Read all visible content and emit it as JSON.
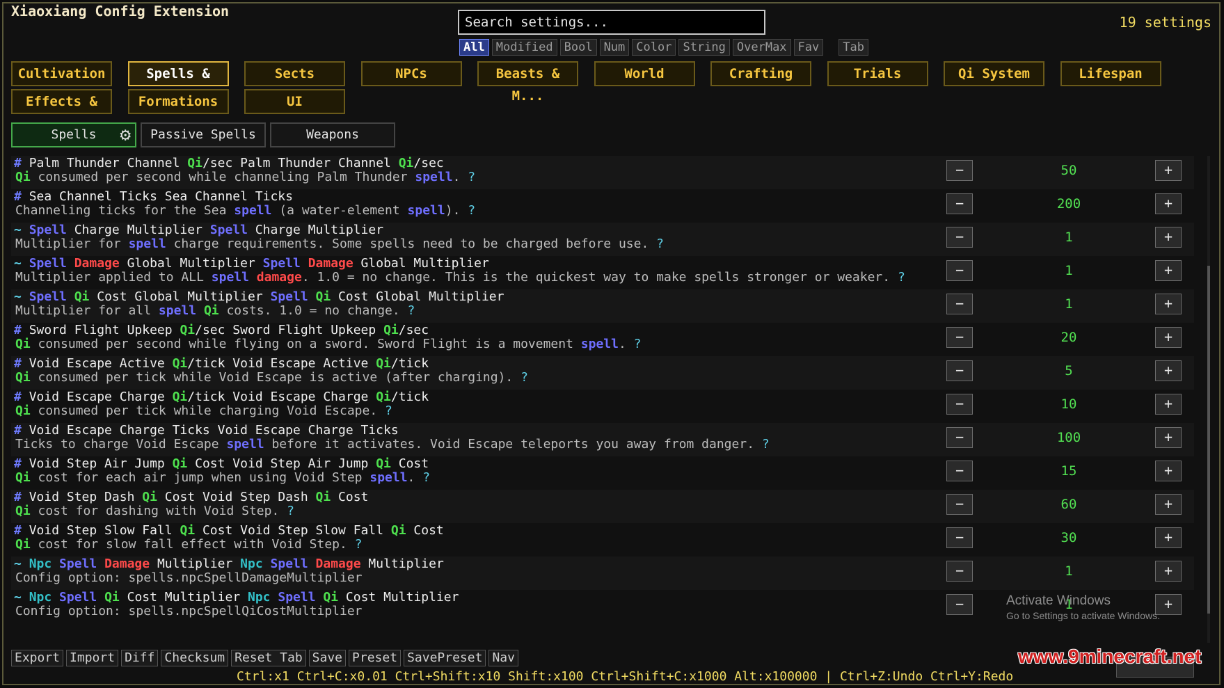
{
  "header": {
    "title": "Xiaoxiang Config Extension",
    "settings_count": "19 settings",
    "search_placeholder": "Search settings..."
  },
  "filters": [
    "All",
    "Modified",
    "Bool",
    "Num",
    "Color",
    "String",
    "OverMax",
    "Fav"
  ],
  "filter_tab": "Tab",
  "categories": [
    "Cultivation",
    "Spells & C...",
    "Sects",
    "NPCs",
    "Beasts & M...",
    "World",
    "Crafting",
    "Trials",
    "Qi System",
    "Lifespan",
    "Effects & ...",
    "Formations",
    "UI"
  ],
  "active_category": "Spells & C...",
  "subtabs": [
    "Spells",
    "Passive Spells",
    "Weapons"
  ],
  "active_subtab": "Spells",
  "settings": [
    {
      "marker": "#",
      "name": [
        [
          "t",
          "Palm Thunder Channel "
        ],
        [
          "qi",
          "Qi"
        ],
        [
          "t",
          "/sec Palm Thunder Channel "
        ],
        [
          "qi",
          "Qi"
        ],
        [
          "t",
          "/sec"
        ]
      ],
      "desc": [
        [
          "qi",
          "Qi"
        ],
        [
          "t",
          " consumed per second while channeling Palm Thunder "
        ],
        [
          "spell",
          "spell"
        ],
        [
          "t",
          "."
        ],
        [
          "help",
          " ?"
        ]
      ],
      "value": "50"
    },
    {
      "marker": "#",
      "name": [
        [
          "t",
          "Sea Channel Ticks Sea Channel Ticks"
        ]
      ],
      "desc": [
        [
          "t",
          "Channeling ticks for the Sea "
        ],
        [
          "spell",
          "spell"
        ],
        [
          "t",
          " (a water-element "
        ],
        [
          "spell",
          "spell"
        ],
        [
          "t",
          ")."
        ],
        [
          "help",
          " ?"
        ]
      ],
      "value": "200"
    },
    {
      "marker": "~",
      "name": [
        [
          "spell",
          "Spell"
        ],
        [
          "t",
          " Charge Multiplier "
        ],
        [
          "spell",
          "Spell"
        ],
        [
          "t",
          " Charge Multiplier"
        ]
      ],
      "desc": [
        [
          "t",
          "Multiplier for "
        ],
        [
          "spell",
          "spell"
        ],
        [
          "t",
          " charge requirements. Some spells need to be charged before use."
        ],
        [
          "help",
          " ?"
        ]
      ],
      "value": "1"
    },
    {
      "marker": "~",
      "name": [
        [
          "spell",
          "Spell"
        ],
        [
          "t",
          " "
        ],
        [
          "dmg",
          "Damage"
        ],
        [
          "t",
          " Global Multiplier "
        ],
        [
          "spell",
          "Spell"
        ],
        [
          "t",
          " "
        ],
        [
          "dmg",
          "Damage"
        ],
        [
          "t",
          " Global Multiplier"
        ]
      ],
      "desc": [
        [
          "t",
          "Multiplier applied to ALL "
        ],
        [
          "spell",
          "spell"
        ],
        [
          "t",
          " "
        ],
        [
          "dmg",
          "damage"
        ],
        [
          "t",
          ". 1.0 = no change. This is the quickest way to make spells stronger or weaker."
        ],
        [
          "help",
          " ?"
        ]
      ],
      "value": "1"
    },
    {
      "marker": "~",
      "name": [
        [
          "spell",
          "Spell"
        ],
        [
          "t",
          " "
        ],
        [
          "qi",
          "Qi"
        ],
        [
          "t",
          " Cost Global Multiplier "
        ],
        [
          "spell",
          "Spell"
        ],
        [
          "t",
          " "
        ],
        [
          "qi",
          "Qi"
        ],
        [
          "t",
          " Cost Global Multiplier"
        ]
      ],
      "desc": [
        [
          "t",
          "Multiplier for all "
        ],
        [
          "spell",
          "spell"
        ],
        [
          "t",
          " "
        ],
        [
          "qi",
          "Qi"
        ],
        [
          "t",
          " costs. 1.0 = no change."
        ],
        [
          "help",
          " ?"
        ]
      ],
      "value": "1"
    },
    {
      "marker": "#",
      "name": [
        [
          "t",
          "Sword Flight Upkeep "
        ],
        [
          "qi",
          "Qi"
        ],
        [
          "t",
          "/sec Sword Flight Upkeep "
        ],
        [
          "qi",
          "Qi"
        ],
        [
          "t",
          "/sec"
        ]
      ],
      "desc": [
        [
          "qi",
          "Qi"
        ],
        [
          "t",
          " consumed per second while flying on a sword. Sword Flight is a movement "
        ],
        [
          "spell",
          "spell"
        ],
        [
          "t",
          "."
        ],
        [
          "help",
          " ?"
        ]
      ],
      "value": "20"
    },
    {
      "marker": "#",
      "name": [
        [
          "t",
          "Void Escape Active "
        ],
        [
          "qi",
          "Qi"
        ],
        [
          "t",
          "/tick Void Escape Active "
        ],
        [
          "qi",
          "Qi"
        ],
        [
          "t",
          "/tick"
        ]
      ],
      "desc": [
        [
          "qi",
          "Qi"
        ],
        [
          "t",
          " consumed per tick while Void Escape is active (after charging)."
        ],
        [
          "help",
          " ?"
        ]
      ],
      "value": "5"
    },
    {
      "marker": "#",
      "name": [
        [
          "t",
          "Void Escape Charge "
        ],
        [
          "qi",
          "Qi"
        ],
        [
          "t",
          "/tick Void Escape Charge "
        ],
        [
          "qi",
          "Qi"
        ],
        [
          "t",
          "/tick"
        ]
      ],
      "desc": [
        [
          "qi",
          "Qi"
        ],
        [
          "t",
          " consumed per tick while charging Void Escape."
        ],
        [
          "help",
          " ?"
        ]
      ],
      "value": "10"
    },
    {
      "marker": "#",
      "name": [
        [
          "t",
          "Void Escape Charge Ticks Void Escape Charge Ticks"
        ]
      ],
      "desc": [
        [
          "t",
          "Ticks to charge Void Escape "
        ],
        [
          "spell",
          "spell"
        ],
        [
          "t",
          " before it activates. Void Escape teleports you away from danger."
        ],
        [
          "help",
          " ?"
        ]
      ],
      "value": "100"
    },
    {
      "marker": "#",
      "name": [
        [
          "t",
          "Void Step Air Jump "
        ],
        [
          "qi",
          "Qi"
        ],
        [
          "t",
          " Cost Void Step Air Jump "
        ],
        [
          "qi",
          "Qi"
        ],
        [
          "t",
          " Cost"
        ]
      ],
      "desc": [
        [
          "qi",
          "Qi"
        ],
        [
          "t",
          " cost for each air jump when using Void Step "
        ],
        [
          "spell",
          "spell"
        ],
        [
          "t",
          "."
        ],
        [
          "help",
          " ?"
        ]
      ],
      "value": "15"
    },
    {
      "marker": "#",
      "name": [
        [
          "t",
          "Void Step Dash "
        ],
        [
          "qi",
          "Qi"
        ],
        [
          "t",
          " Cost Void Step Dash "
        ],
        [
          "qi",
          "Qi"
        ],
        [
          "t",
          " Cost"
        ]
      ],
      "desc": [
        [
          "qi",
          "Qi"
        ],
        [
          "t",
          " cost for dashing with Void Step."
        ],
        [
          "help",
          " ?"
        ]
      ],
      "value": "60"
    },
    {
      "marker": "#",
      "name": [
        [
          "t",
          "Void Step Slow Fall "
        ],
        [
          "qi",
          "Qi"
        ],
        [
          "t",
          " Cost Void Step Slow Fall "
        ],
        [
          "qi",
          "Qi"
        ],
        [
          "t",
          " Cost"
        ]
      ],
      "desc": [
        [
          "qi",
          "Qi"
        ],
        [
          "t",
          " cost for slow fall effect with Void Step."
        ],
        [
          "help",
          " ?"
        ]
      ],
      "value": "30"
    },
    {
      "marker": "~",
      "name": [
        [
          "npc",
          "Npc"
        ],
        [
          "t",
          " "
        ],
        [
          "spell",
          "Spell"
        ],
        [
          "t",
          " "
        ],
        [
          "dmg",
          "Damage"
        ],
        [
          "t",
          " Multiplier "
        ],
        [
          "npc",
          "Npc"
        ],
        [
          "t",
          " "
        ],
        [
          "spell",
          "Spell"
        ],
        [
          "t",
          " "
        ],
        [
          "dmg",
          "Damage"
        ],
        [
          "t",
          " Multiplier"
        ]
      ],
      "desc": [
        [
          "t",
          "Config option: spells.npcSpellDamageMultiplier"
        ]
      ],
      "value": "1"
    },
    {
      "marker": "~",
      "name": [
        [
          "npc",
          "Npc"
        ],
        [
          "t",
          " "
        ],
        [
          "spell",
          "Spell"
        ],
        [
          "t",
          " "
        ],
        [
          "qi",
          "Qi"
        ],
        [
          "t",
          " Cost Multiplier "
        ],
        [
          "npc",
          "Npc"
        ],
        [
          "t",
          " "
        ],
        [
          "spell",
          "Spell"
        ],
        [
          "t",
          " "
        ],
        [
          "qi",
          "Qi"
        ],
        [
          "t",
          " Cost Multiplier"
        ]
      ],
      "desc": [
        [
          "t",
          "Config option: spells.npcSpellQiCostMultiplier"
        ]
      ],
      "value": "1"
    }
  ],
  "stepper": {
    "minus": "−",
    "plus": "+"
  },
  "bottom_buttons": [
    "Export",
    "Import",
    "Diff",
    "Checksum",
    "Reset Tab",
    "Save",
    "Preset",
    "SavePreset",
    "Nav"
  ],
  "shortcuts": "Ctrl:x1  Ctrl+C:x0.01  Ctrl+Shift:x10  Shift:x100  Ctrl+Shift+C:x1000  Alt:x100000  |  Ctrl+Z:Undo  Ctrl+Y:Redo",
  "watermark": {
    "title": "Activate Windows",
    "subtitle": "Go to Settings to activate Windows."
  },
  "site_watermark": "www.9minecraft.net",
  "colors": {
    "qi": "#4ee04e",
    "spell": "#6f6fff",
    "damage": "#ff4a4a",
    "npc": "#33c0c8",
    "value": "#52e052",
    "category_text": "#f6c640",
    "shortcut_text": "#f2dc62"
  }
}
